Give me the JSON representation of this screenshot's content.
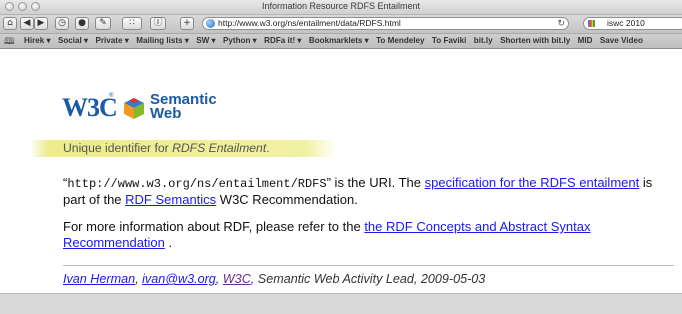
{
  "window": {
    "title": "Information Resource RDFS Entailment"
  },
  "toolbar": {
    "url": "http://www.w3.org/ns/entailment/data/RDFS.html",
    "reload_glyph": "↻",
    "search_text": "iswc 2010",
    "buttons": [
      {
        "name": "home-icon",
        "glyph": "⌂"
      },
      {
        "name": "back-icon",
        "glyph": "◀"
      },
      {
        "name": "forward-icon",
        "glyph": "▶"
      },
      {
        "name": "history-icon",
        "glyph": "◷"
      },
      {
        "name": "stop-icon",
        "glyph": "●"
      },
      {
        "name": "edit-icon",
        "glyph": "✎"
      },
      {
        "name": "grid-icon",
        "glyph": "∷"
      },
      {
        "name": "info-icon",
        "glyph": "Ⓘ"
      },
      {
        "name": "add-bookmark-icon",
        "glyph": "+"
      }
    ]
  },
  "bookmarks": [
    "Hirek ▾",
    "Social ▾",
    "Private ▾",
    "Mailing lists ▾",
    "SW ▾",
    "Python ▾",
    "RDFa it! ▾",
    "Bookmarklets ▾",
    "To Mendeley",
    "To Faviki",
    "bit.ly",
    "Shorten with bit.ly",
    "MID",
    "Save Video"
  ],
  "logo": {
    "w3c": "W3C",
    "line1": "Semantic",
    "line2": "Web"
  },
  "content": {
    "identifier_prefix": "Unique identifier for ",
    "identifier_em": "RDFS Entailment",
    "identifier_suffix": ".",
    "p1": {
      "quote_open": "“",
      "uri": "http://www.w3.org/ns/entailment/RDFS",
      "quote_close": "”",
      "text1": " is the URI. The ",
      "link1": "specification for the RDFS entailment",
      "text2": " is part of the ",
      "link2": "RDF Semantics",
      "text3": " W3C Recommendation."
    },
    "p2": {
      "text1": "For more information about RDF, please refer to the ",
      "link1": "the RDF Concepts and Abstract Syntax Recommendation",
      "text2": " ."
    },
    "footer": {
      "author": "Ivan Herman",
      "sep1": ", ",
      "email": "ivan@w3.org",
      "sep2": ", ",
      "org": "W3C",
      "rest": ", Semantic Web Activity Lead, 2009-05-03"
    }
  },
  "colors": {
    "link": "#1a1aee",
    "visited": "#6a2a8f",
    "logo_blue": "#1a5aa6",
    "highlight": "#eeee8c"
  }
}
